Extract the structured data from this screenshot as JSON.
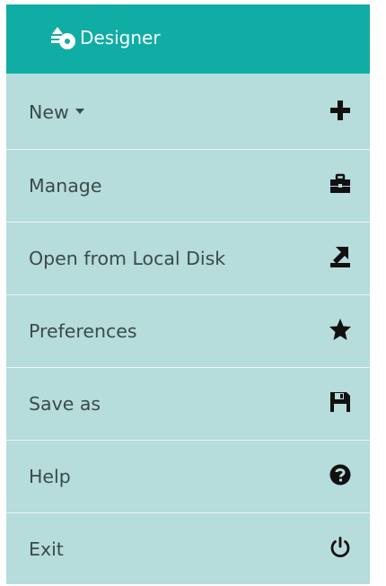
{
  "app": {
    "title": "Designer",
    "logo_icon": "designer-logo-icon",
    "accent_color": "#10ada5",
    "menu_background": "#b6dcdb"
  },
  "menu": {
    "items": [
      {
        "label": "New",
        "icon": "plus-icon",
        "has_dropdown": true
      },
      {
        "label": "Manage",
        "icon": "briefcase-icon"
      },
      {
        "label": "Open from Local Disk",
        "icon": "upload-icon"
      },
      {
        "label": "Preferences",
        "icon": "star-icon"
      },
      {
        "label": "Save as",
        "icon": "floppy-disk-icon"
      },
      {
        "label": "Help",
        "icon": "question-circle-icon"
      },
      {
        "label": "Exit",
        "icon": "power-icon"
      }
    ]
  }
}
